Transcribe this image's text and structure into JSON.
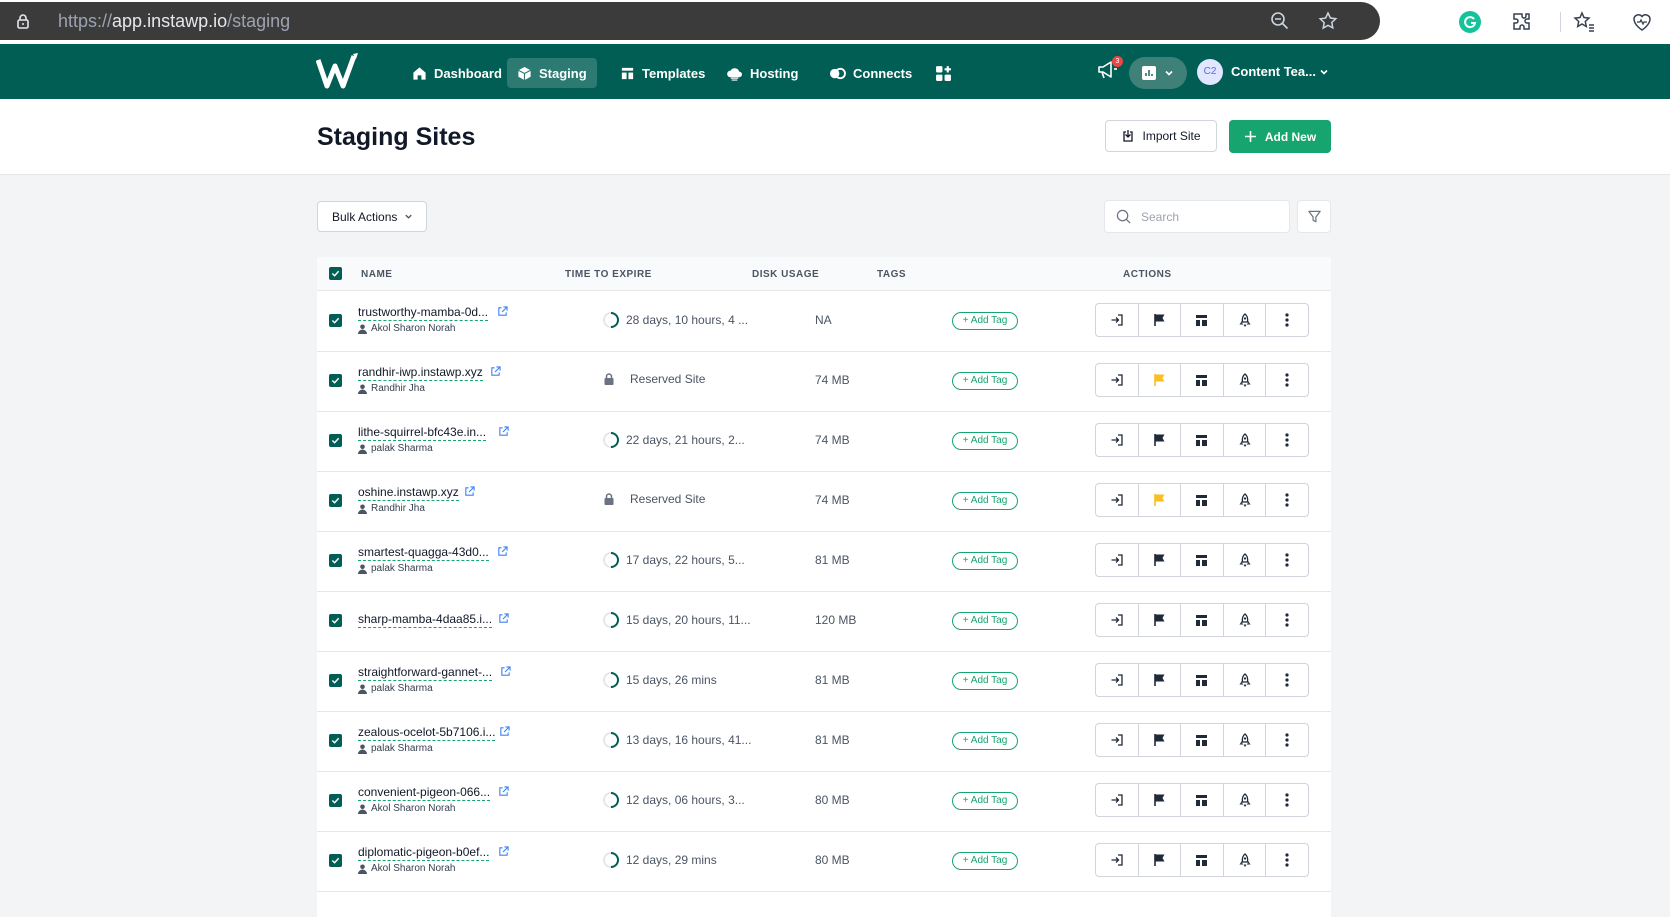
{
  "browser": {
    "url_prefix": "https://",
    "url_host": "app.instawp.io",
    "url_path": "/staging"
  },
  "nav": {
    "items": [
      {
        "label": "Dashboard",
        "icon": "home-icon"
      },
      {
        "label": "Staging",
        "icon": "cube-icon",
        "active": true
      },
      {
        "label": "Templates",
        "icon": "template-icon"
      },
      {
        "label": "Hosting",
        "icon": "cloud-icon"
      },
      {
        "label": "Connects",
        "icon": "connects-icon"
      }
    ],
    "notification_count": "3",
    "avatar_initials": "C2",
    "user_name": "Content Tea..."
  },
  "header": {
    "title": "Staging Sites",
    "import_label": "Import Site",
    "add_label": "Add New"
  },
  "toolbar": {
    "bulk_label": "Bulk Actions",
    "search_placeholder": "Search"
  },
  "table": {
    "columns": [
      "NAME",
      "TIME TO EXPIRE",
      "DISK USAGE",
      "TAGS",
      "ACTIONS"
    ],
    "add_tag_label": "+ Add Tag",
    "rows": [
      {
        "name": "trustworthy-mamba-0d...",
        "owner": "Akol Sharon Norah",
        "expire": "28 days, 10 hours, 4 ...",
        "reserved": false,
        "disk": "NA",
        "flag_color": "#1f2937"
      },
      {
        "name": "randhir-iwp.instawp.xyz",
        "owner": "Randhir Jha",
        "expire": "Reserved Site",
        "reserved": true,
        "disk": "74 MB",
        "flag_color": "#fbbf24"
      },
      {
        "name": "lithe-squirrel-bfc43e.in...",
        "owner": "palak Sharma",
        "expire": "22 days, 21 hours, 2...",
        "reserved": false,
        "disk": "74 MB",
        "flag_color": "#1f2937"
      },
      {
        "name": "oshine.instawp.xyz",
        "owner": "Randhir Jha",
        "expire": "Reserved Site",
        "reserved": true,
        "disk": "74 MB",
        "flag_color": "#fbbf24"
      },
      {
        "name": "smartest-quagga-43d0...",
        "owner": "palak Sharma",
        "expire": "17 days, 22 hours, 5...",
        "reserved": false,
        "disk": "81 MB",
        "flag_color": "#1f2937"
      },
      {
        "name": "sharp-mamba-4daa85.i...",
        "owner": "",
        "expire": "15 days, 20 hours, 11...",
        "reserved": false,
        "disk": "120 MB",
        "flag_color": "#1f2937"
      },
      {
        "name": "straightforward-gannet-...",
        "owner": "palak Sharma",
        "expire": "15 days, 26 mins",
        "reserved": false,
        "disk": "81 MB",
        "flag_color": "#1f2937"
      },
      {
        "name": "zealous-ocelot-5b7106.i...",
        "owner": "palak Sharma",
        "expire": "13 days, 16 hours, 41...",
        "reserved": false,
        "disk": "81 MB",
        "flag_color": "#1f2937"
      },
      {
        "name": "convenient-pigeon-066...",
        "owner": "Akol Sharon Norah",
        "expire": "12 days, 06 hours, 3...",
        "reserved": false,
        "disk": "80 MB",
        "flag_color": "#1f2937"
      },
      {
        "name": "diplomatic-pigeon-b0ef...",
        "owner": "Akol Sharon Norah",
        "expire": "12 days, 29 mins",
        "reserved": false,
        "disk": "80 MB",
        "flag_color": "#1f2937"
      }
    ]
  },
  "colors": {
    "brand": "#005e54",
    "accent": "#16a46f"
  }
}
